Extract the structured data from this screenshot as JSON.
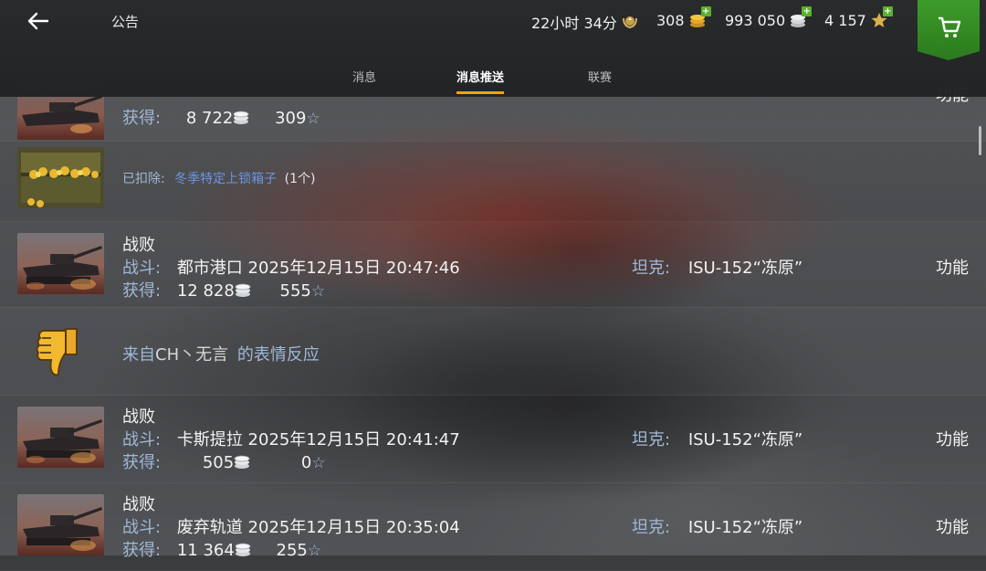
{
  "header": {
    "title": "公告",
    "timer": "22小时 34分",
    "gold": "308",
    "silver": "993 050",
    "free_xp": "4 157"
  },
  "tabs": [
    {
      "label": "消息",
      "active": false
    },
    {
      "label": "消息推送",
      "active": true
    },
    {
      "label": "联赛",
      "active": false
    }
  ],
  "rows": [
    {
      "type": "battle",
      "result": "",
      "battle_label": "",
      "battle_value": "",
      "earn_label": "获得:",
      "silver": "8 722",
      "xp": "309",
      "tank_label": "",
      "tank_value": "",
      "func": "功能"
    },
    {
      "type": "info",
      "prefix": "已扣除:",
      "item": "冬季特定上锁箱子",
      "count": "(1个)"
    },
    {
      "type": "battle",
      "result": "战败",
      "battle_label": "战斗:",
      "battle_value": "都市港口 2025年12月15日 20:47:46",
      "earn_label": "获得:",
      "silver": "12 828",
      "xp": "555",
      "tank_label": "坦克:",
      "tank_value": "ISU-152“冻原”",
      "func": "功能"
    },
    {
      "type": "reaction",
      "from": "来自",
      "player": "CH丶无言",
      "suffix": "的表情反应"
    },
    {
      "type": "battle",
      "result": "战败",
      "battle_label": "战斗:",
      "battle_value": "卡斯提拉 2025年12月15日 20:41:47",
      "earn_label": "获得:",
      "silver": "505",
      "xp": "0",
      "tank_label": "坦克:",
      "tank_value": "ISU-152“冻原”",
      "func": "功能"
    },
    {
      "type": "battle",
      "result": "战败",
      "battle_label": "战斗:",
      "battle_value": "废弃轨道 2025年12月15日 20:35:04",
      "earn_label": "获得:",
      "silver": "11 364",
      "xp": "255",
      "tank_label": "坦克:",
      "tank_value": "ISU-152“冻原”",
      "func": "功能"
    }
  ],
  "icons": {
    "back": "arrow-left-icon",
    "timer": "premium-laurel-icon",
    "gold": "gold-coins-icon",
    "silver": "silver-coins-icon",
    "free_xp": "free-xp-star-icon",
    "shop": "shopping-cart-icon",
    "reaction": "thumbs-down-icon"
  },
  "colors": {
    "accent": "#f0a020",
    "label_blue": "#9fb8d6",
    "item_link": "#6a95e0",
    "shop_green": "#3d9b2a",
    "plus_green": "#5ab12c"
  }
}
